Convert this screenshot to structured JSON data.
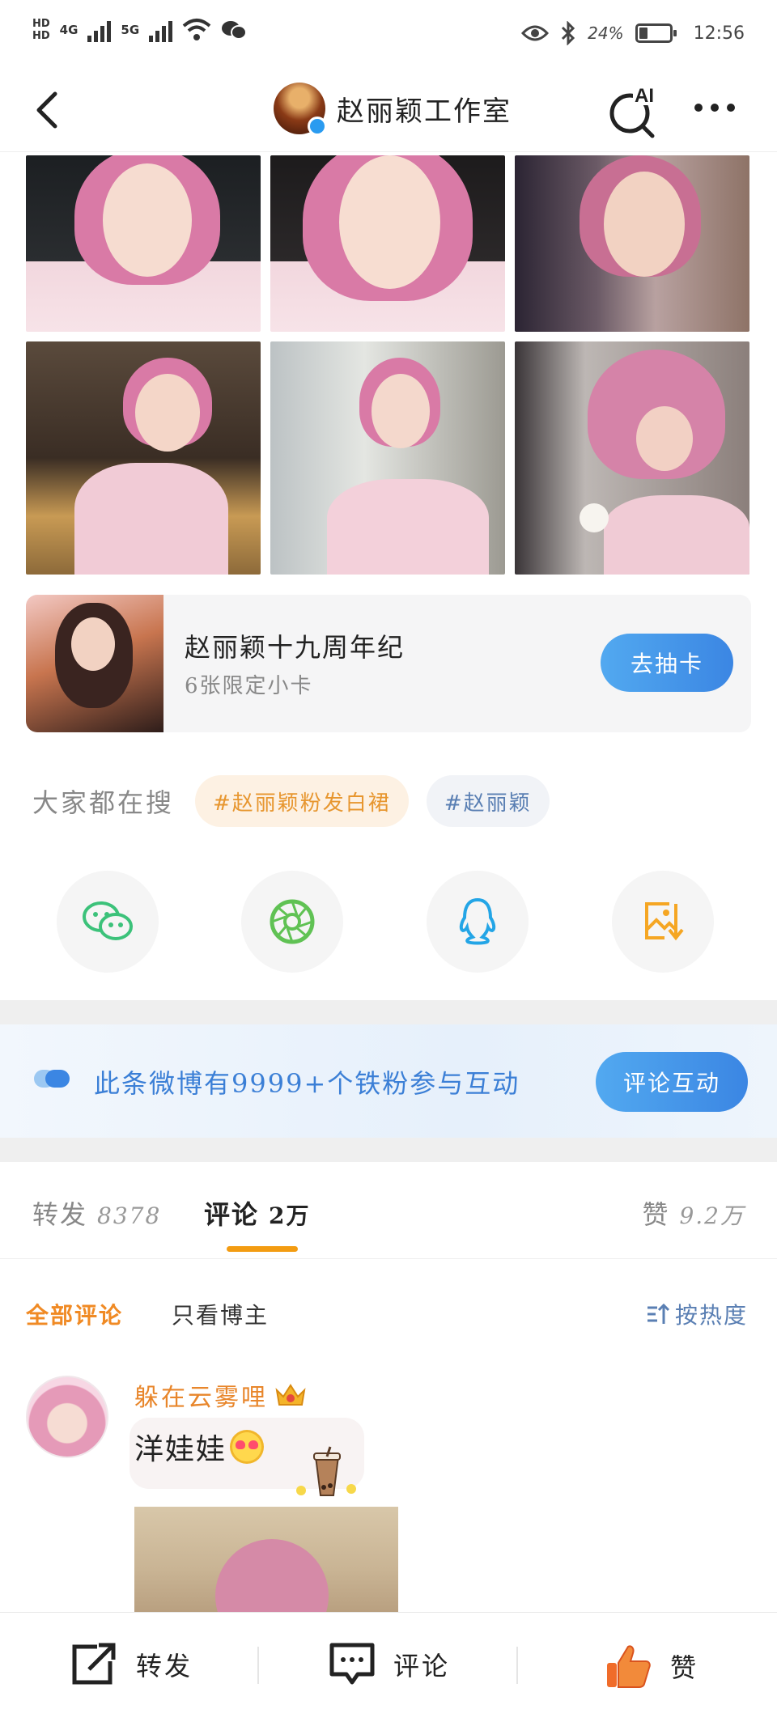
{
  "status_bar": {
    "hd1": "HD",
    "hd2": "HD",
    "net1": "4G",
    "net2": "5G",
    "battery": "24%",
    "time": "12:56"
  },
  "nav": {
    "title": "赵丽颖工作室",
    "ai_label": "AI"
  },
  "promo": {
    "title": "赵丽颖十九周年纪",
    "subtitle": "6张限定小卡",
    "button": "去抽卡"
  },
  "hot_search": {
    "label": "大家都在搜",
    "tags": [
      "#赵丽颖粉发白裙",
      "#赵丽颖"
    ]
  },
  "share": {
    "items": [
      "wechat-icon",
      "moments-icon",
      "qq-icon",
      "save-image-icon"
    ]
  },
  "fan_banner": {
    "text": "此条微博有9999+个铁粉参与互动",
    "button": "评论互动"
  },
  "tabs": {
    "repost_label": "转发",
    "repost_count": "8378",
    "comment_label": "评论",
    "comment_count": "2万",
    "like_label": "赞",
    "like_count": "9.2万"
  },
  "filter": {
    "all": "全部评论",
    "blogger_only": "只看博主",
    "sort": "按热度"
  },
  "comment": {
    "user": "躲在云雾哩",
    "text": "洋娃娃"
  },
  "bottom_bar": {
    "repost": "转发",
    "comment": "评论",
    "like": "赞"
  },
  "colors": {
    "accent_orange": "#f08a24",
    "accent_blue": "#3b86e3",
    "link_blue": "#5a7fb3"
  }
}
